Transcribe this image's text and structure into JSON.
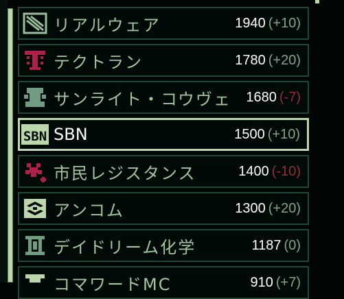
{
  "factions": [
    {
      "name": "リアルウェア",
      "score": "1940",
      "delta": "(+10)",
      "negative": false,
      "icon": "realware-emblem-icon",
      "color": "#9bbf9a"
    },
    {
      "name": "テクトラン",
      "score": "1780",
      "delta": "(+20)",
      "negative": false,
      "icon": "techtran-emblem-icon",
      "color": "#b0204a"
    },
    {
      "name": "サンライト・コウヴェ",
      "score": "1680",
      "delta": "(-7)",
      "negative": true,
      "icon": "sunlight-emblem-icon",
      "color": "#6f9c83"
    },
    {
      "name": "SBN",
      "score": "1500",
      "delta": "(+10)",
      "negative": false,
      "icon": "sbn-emblem-icon",
      "color": "#bcd7ab",
      "selected": true
    },
    {
      "name": "市民レジスタンス",
      "score": "1400",
      "delta": "(-10)",
      "negative": true,
      "icon": "resistance-emblem-icon",
      "color": "#b0204a"
    },
    {
      "name": "アンコム",
      "score": "1300",
      "delta": "(+20)",
      "negative": false,
      "icon": "ancom-emblem-icon",
      "color": "#bcd7ab"
    },
    {
      "name": "デイドリーム化学",
      "score": "1187",
      "delta": "(0)",
      "negative": false,
      "icon": "daydream-emblem-icon",
      "color": "#6f9c83"
    },
    {
      "name": "コマワードMC",
      "score": "910",
      "delta": "(+7)",
      "negative": false,
      "icon": "commaward-emblem-icon",
      "color": "#bcd7ab"
    }
  ]
}
